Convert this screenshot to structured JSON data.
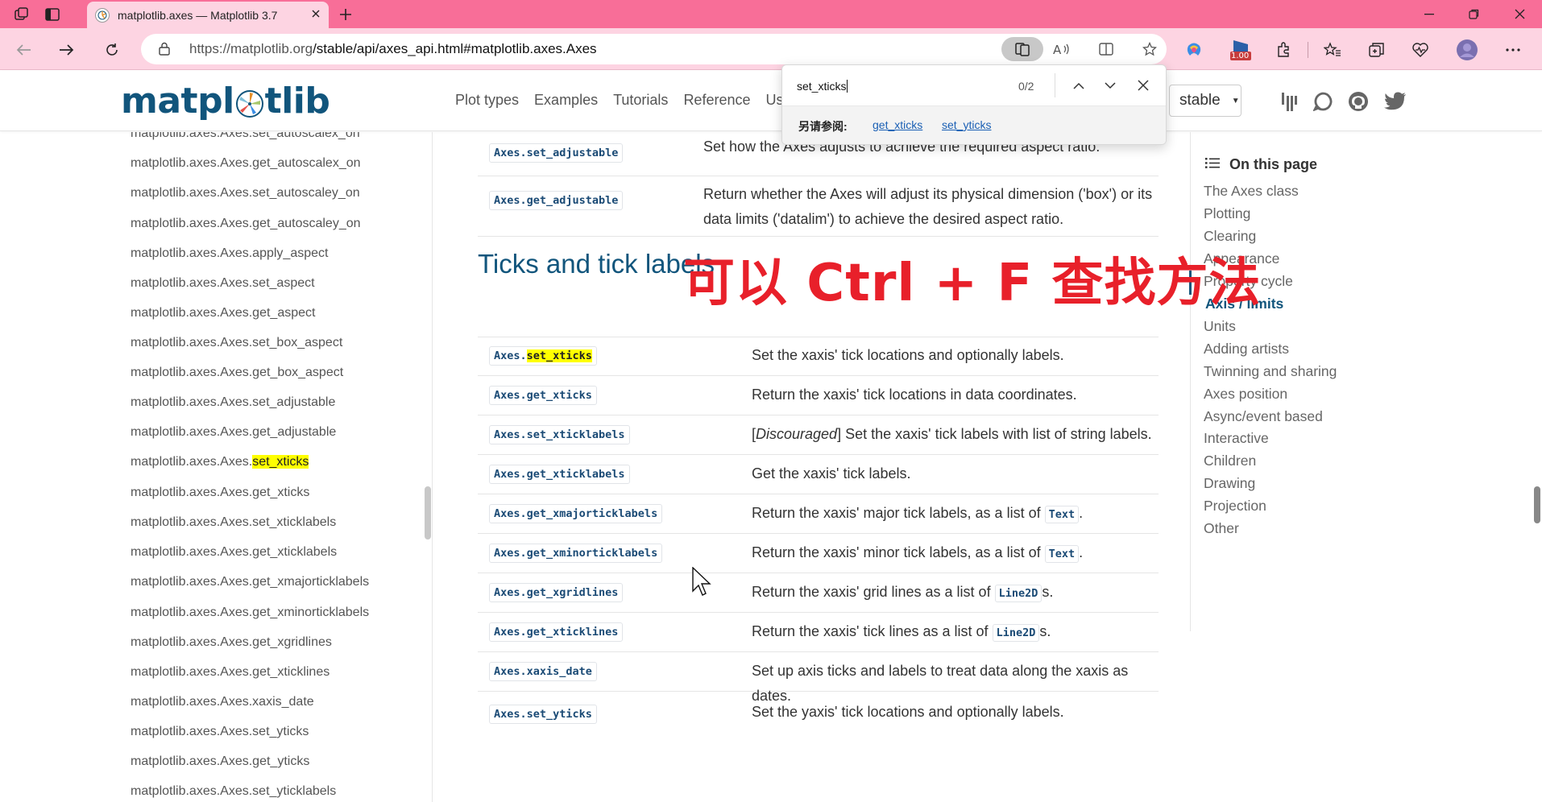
{
  "browser": {
    "tab_title": "matplotlib.axes — Matplotlib 3.7",
    "url_host": "https://matplotlib.org",
    "url_path": "/stable/api/axes_api.html#matplotlib.axes.Axes",
    "speed_badge": "1.00",
    "accent": "#f86e98"
  },
  "header": {
    "logo_pre": "matpl",
    "logo_post": "tlib",
    "nav": [
      "Plot types",
      "Examples",
      "Tutorials",
      "Reference",
      "Us"
    ],
    "version": "stable"
  },
  "find": {
    "query": "set_xticks",
    "count": "0/2",
    "see_also_label": "另请参阅:",
    "see_also": [
      "get_xticks",
      "set_yticks"
    ]
  },
  "left_sidebar": {
    "prefix": "matplotlib.axes.Axes.",
    "items": [
      "matplotlib.axes.Axes.set_autoscalex_on",
      "matplotlib.axes.Axes.get_autoscalex_on",
      "matplotlib.axes.Axes.set_autoscaley_on",
      "matplotlib.axes.Axes.get_autoscaley_on",
      "matplotlib.axes.Axes.apply_aspect",
      "matplotlib.axes.Axes.set_aspect",
      "matplotlib.axes.Axes.get_aspect",
      "matplotlib.axes.Axes.set_box_aspect",
      "matplotlib.axes.Axes.get_box_aspect",
      "matplotlib.axes.Axes.set_adjustable",
      "matplotlib.axes.Axes.get_adjustable",
      "set_xticks",
      "matplotlib.axes.Axes.get_xticks",
      "matplotlib.axes.Axes.set_xticklabels",
      "matplotlib.axes.Axes.get_xticklabels",
      "matplotlib.axes.Axes.get_xmajorticklabels",
      "matplotlib.axes.Axes.get_xminorticklabels",
      "matplotlib.axes.Axes.get_xgridlines",
      "matplotlib.axes.Axes.get_xticklines",
      "matplotlib.axes.Axes.xaxis_date",
      "matplotlib.axes.Axes.set_yticks",
      "matplotlib.axes.Axes.get_yticks",
      "matplotlib.axes.Axes.set_yticklabels"
    ]
  },
  "main": {
    "pre_rows": [
      {
        "code": "Axes.set_adjustable",
        "desc": "Set how the Axes adjusts to achieve the required aspect ratio."
      },
      {
        "code": "Axes.get_adjustable",
        "desc1": "Return whether the Axes will adjust its physical dimension ('box') or its",
        "desc2": "data limits ('datalim') to achieve the desired aspect ratio."
      }
    ],
    "section_title": "Ticks and tick labels",
    "rows": [
      {
        "code_pre": "Axes.",
        "code_hl": "set_xticks",
        "desc": "Set the xaxis' tick locations and optionally labels."
      },
      {
        "code": "Axes.get_xticks",
        "desc": "Return the xaxis' tick locations in data coordinates."
      },
      {
        "code": "Axes.set_xticklabels",
        "desc_em": "Discouraged",
        "desc": "] Set the xaxis' tick labels with list of string labels."
      },
      {
        "code": "Axes.get_xticklabels",
        "desc": "Get the xaxis' tick labels."
      },
      {
        "code": "Axes.get_xmajorticklabels",
        "desc": "Return the xaxis' major tick labels, as a list of",
        "inline": "Text",
        "tail": "."
      },
      {
        "code": "Axes.get_xminorticklabels",
        "desc": "Return the xaxis' minor tick labels, as a list of",
        "inline": "Text",
        "tail": "."
      },
      {
        "code": "Axes.get_xgridlines",
        "desc": "Return the xaxis' grid lines as a list of",
        "inline": "Line2D",
        "tail": "s."
      },
      {
        "code": "Axes.get_xticklines",
        "desc": "Return the xaxis' tick lines as a list of",
        "inline": "Line2D",
        "tail": "s."
      },
      {
        "code": "Axes.xaxis_date",
        "desc": "Set up axis ticks and labels to treat data along the xaxis as dates."
      },
      {
        "code": "Axes.set_yticks",
        "desc": "Set the yaxis' tick locations and optionally labels."
      }
    ]
  },
  "right_sidebar": {
    "title": "On this page",
    "items": [
      "The Axes class",
      "Plotting",
      "Clearing",
      "Appearance",
      "Property cycle",
      "Axis / limits",
      "Units",
      "Adding artists",
      "Twinning and sharing",
      "Axes position",
      "Async/event based",
      "Interactive",
      "Children",
      "Drawing",
      "Projection",
      "Other"
    ],
    "active": "Axis / limits"
  },
  "overlay": {
    "text": "可以 Ctrl  + F 查找方法",
    "color": "#e8202a"
  }
}
